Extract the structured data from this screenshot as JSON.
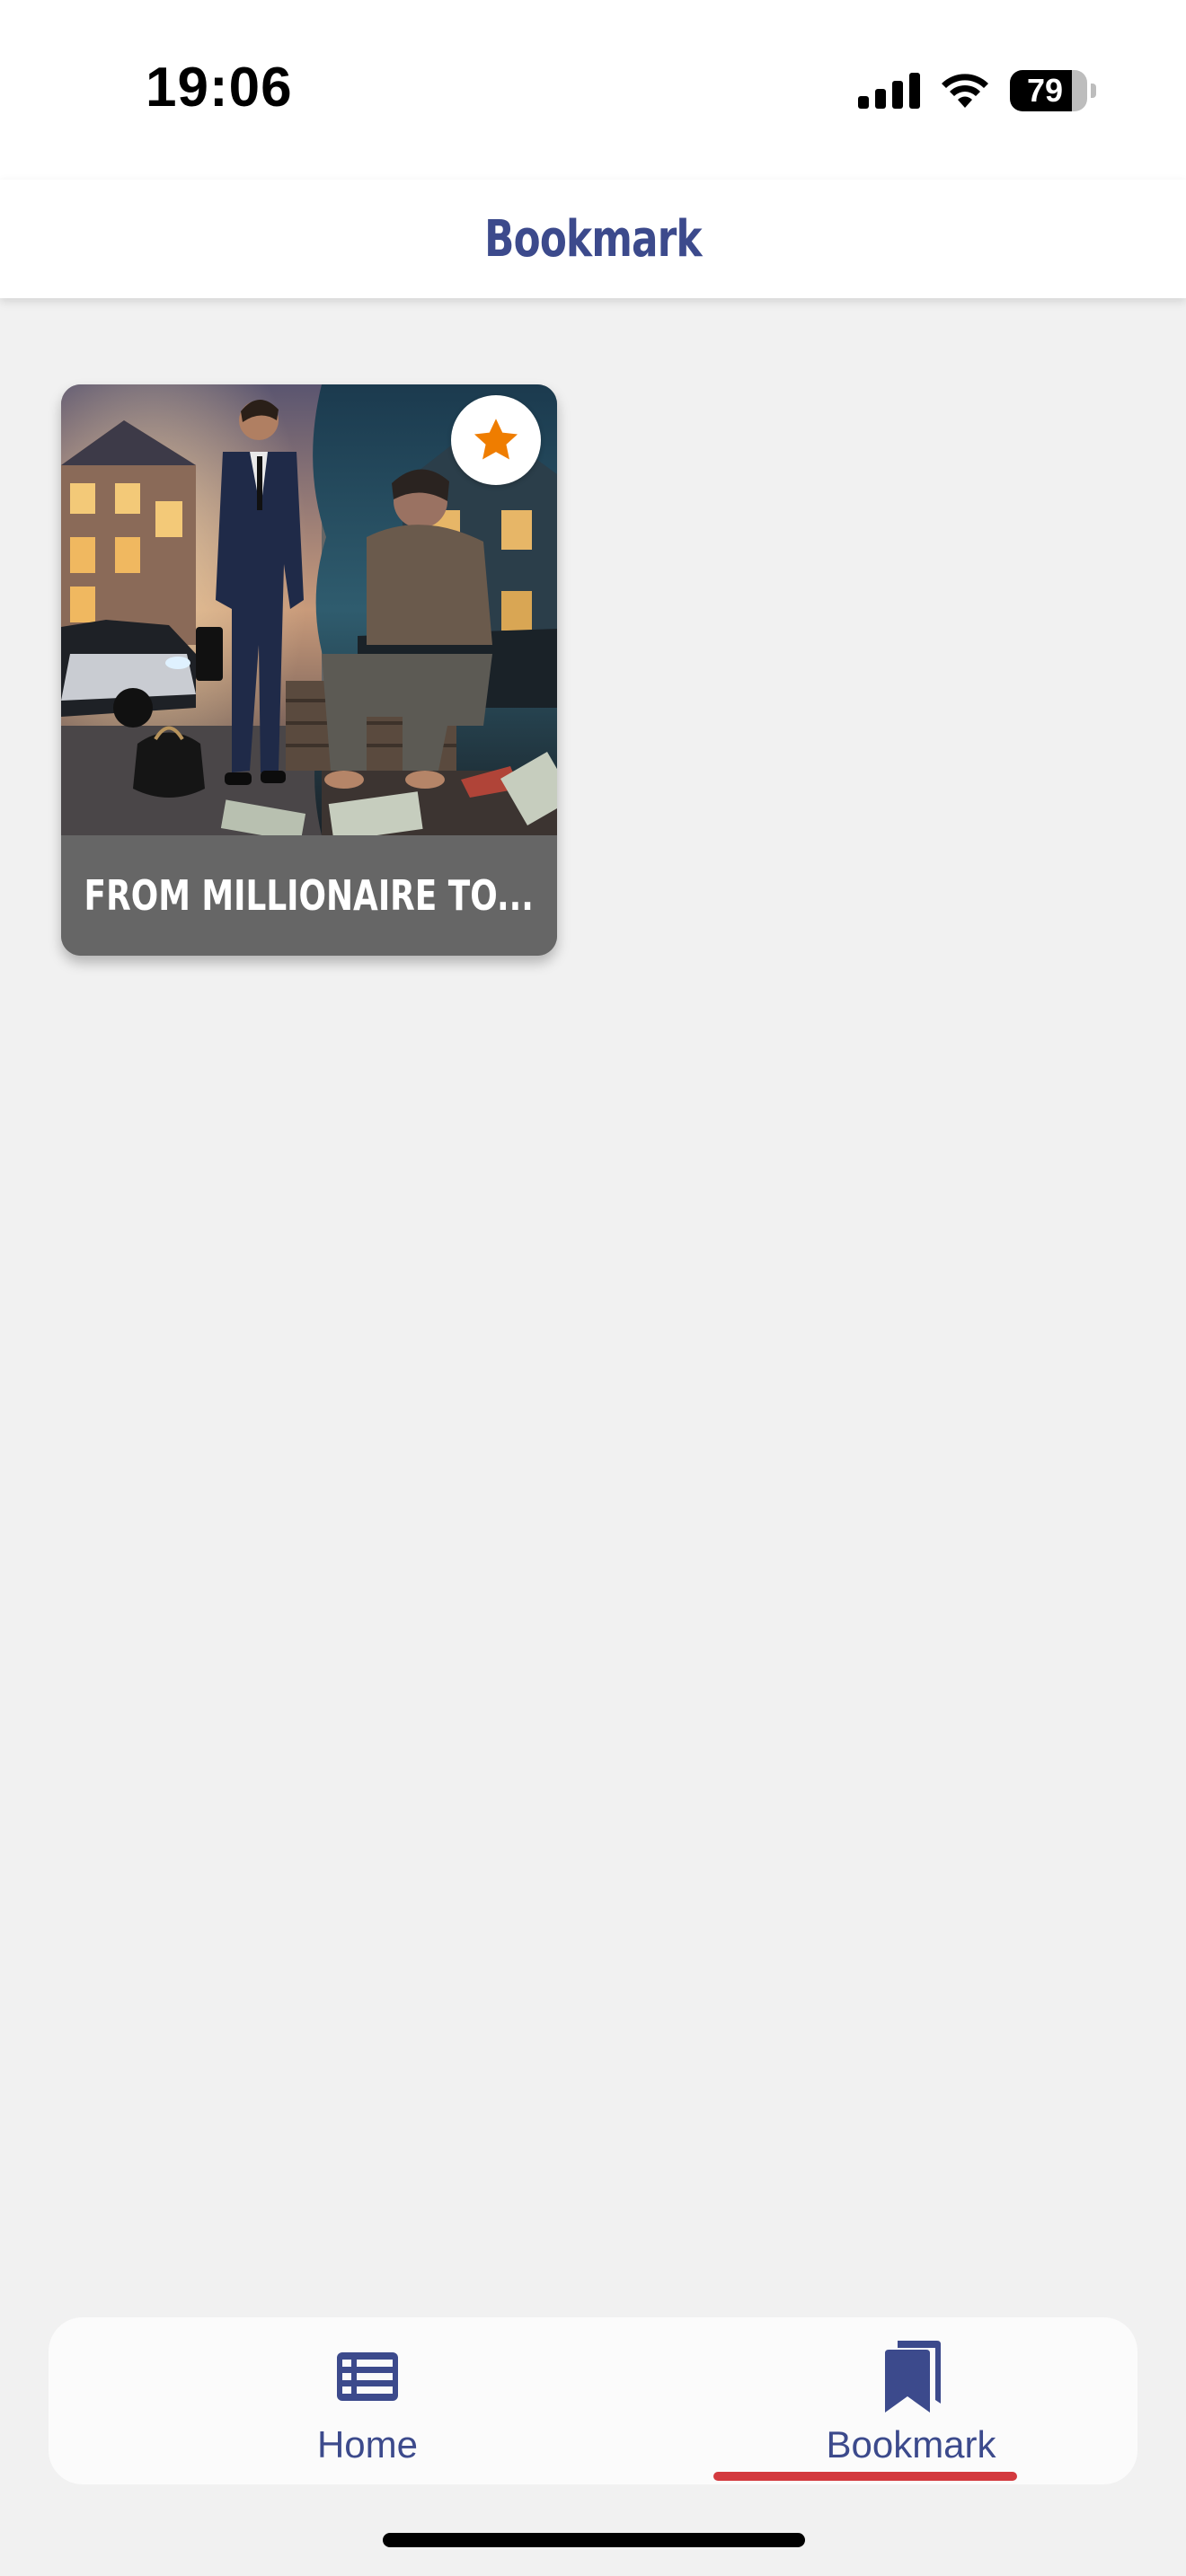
{
  "status_bar": {
    "time": "19:06",
    "battery": "79"
  },
  "header": {
    "title": "Bookmark"
  },
  "bookmarks": [
    {
      "title": "FROM MILLIONAIRE TO...",
      "bookmarked": true,
      "badge_icon": "star-icon",
      "badge_color": "#ef7d00"
    }
  ],
  "bottom_nav": {
    "items": [
      {
        "label": "Home",
        "icon": "list-icon",
        "active": false
      },
      {
        "label": "Bookmark",
        "icon": "bookmarks-icon",
        "active": true
      }
    ],
    "active_color": "#3c4a8c",
    "indicator_color": "#d33a3f"
  }
}
